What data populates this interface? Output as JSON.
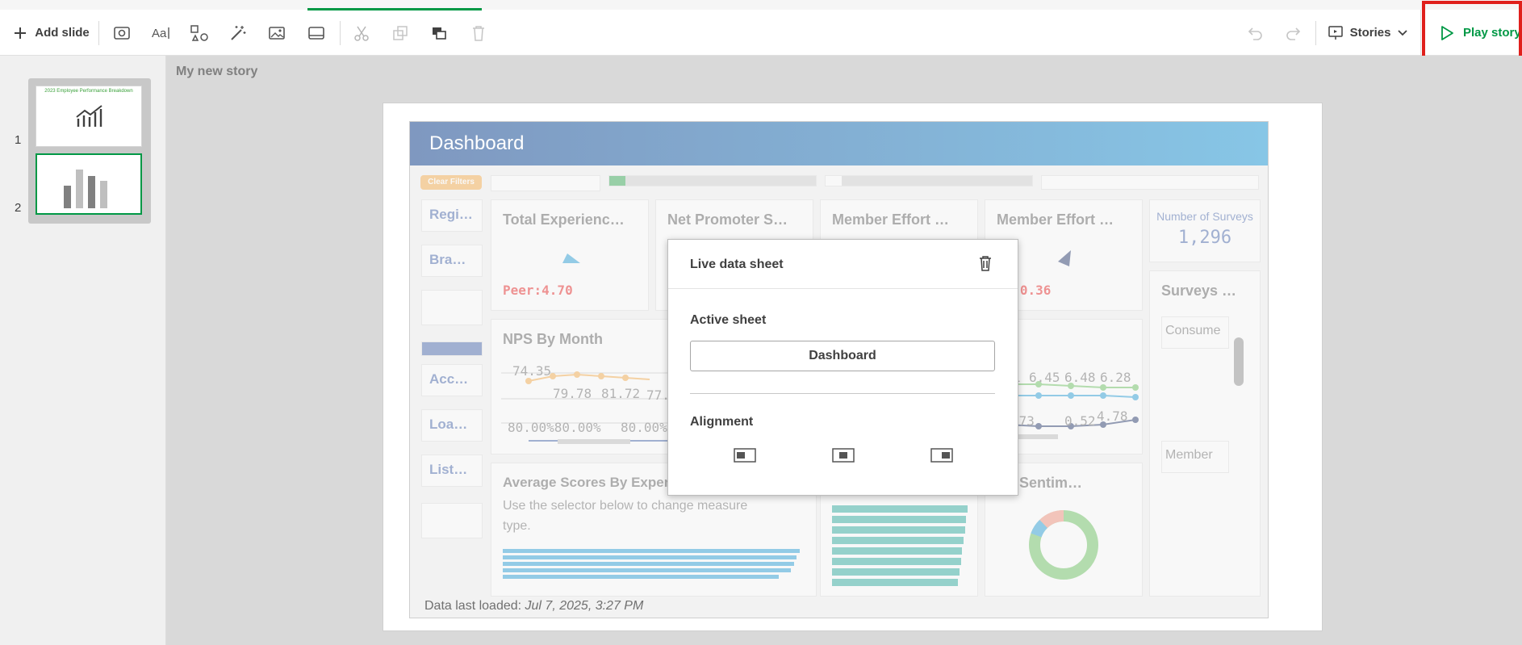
{
  "toolbar": {
    "add_slide_label": "Add slide",
    "stories_label": "Stories",
    "play_story_label": "Play story"
  },
  "slides": {
    "numbers": [
      "1",
      "2"
    ],
    "thumb1_title": "2023 Employee Performance Breakdown"
  },
  "story": {
    "title": "My new story"
  },
  "dashboard": {
    "title": "Dashboard",
    "clear_filters": "Clear Filters",
    "filters": [
      "Regi…",
      "Bra…",
      "Acc…",
      "Loa…",
      "List…"
    ],
    "kpis": {
      "total_experience": "Total Experienc…",
      "net_promoter": "Net Promoter S…",
      "member_effort_1": "Member Effort …",
      "member_effort_2": "Member Effort …",
      "surveys_label": "Number of Surveys",
      "surveys_value": "1,296",
      "peer_1": "Peer:4.70",
      "peer_2": "er:0.36"
    },
    "nps_title": "NPS By Month",
    "nps_values_top": [
      "74.35",
      "79.78",
      "81.72",
      "77.6"
    ],
    "nps_values_bottom": [
      "80.00%80.00%",
      "80.00%"
    ],
    "right_chart_values_top": [
      "1",
      "6.45",
      "6.48",
      "6.28"
    ],
    "right_chart_values_bottom": [
      ".73",
      "0.52",
      "4.78"
    ],
    "avg_title": "Average Scores By Exper",
    "avg_subtitle": "Use the selector below to change measure type.",
    "sentiment_title": "erall Sentim…",
    "surveys_panel_title": "Surveys …",
    "surveys_panel_items": [
      "Consume",
      "Member"
    ],
    "data_loaded_label": "Data last loaded:",
    "data_loaded_value": "Jul 7, 2025, 3:27 PM"
  },
  "popup": {
    "title": "Live data sheet",
    "active_sheet_label": "Active sheet",
    "active_sheet_value": "Dashboard",
    "alignment_label": "Alignment"
  },
  "colors": {
    "accent_green": "#009845",
    "highlight_red": "#e0201c",
    "peer_red": "#e81c1c",
    "header_blue": "#7f98c0"
  }
}
